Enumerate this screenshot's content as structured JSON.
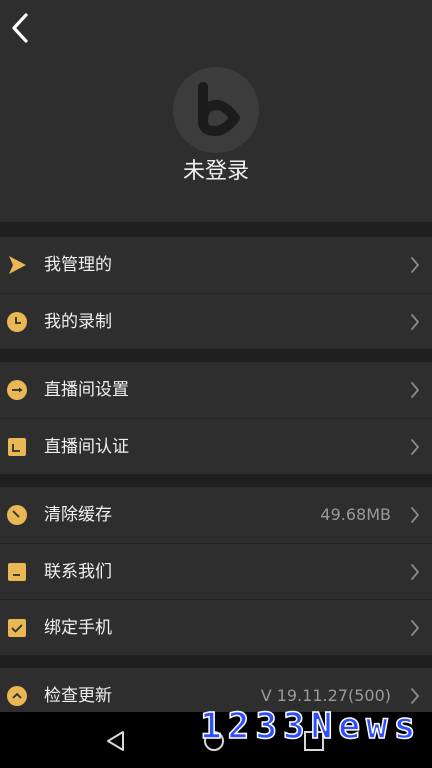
{
  "header": {
    "back_icon": "chevron-left-icon",
    "avatar_icon": "b-logo-icon",
    "login_status": "未登录"
  },
  "menu": {
    "groups": [
      {
        "items": [
          {
            "label": "我管理的",
            "icon": "play-flag-icon"
          },
          {
            "label": "我的录制",
            "icon": "clock-icon"
          }
        ]
      },
      {
        "items": [
          {
            "label": "直播间设置",
            "icon": "arrow-circle-icon"
          },
          {
            "label": "直播间认证",
            "icon": "check-square-icon"
          }
        ]
      },
      {
        "items": [
          {
            "label": "清除缓存",
            "icon": "clean-icon",
            "value": "49.68MB"
          },
          {
            "label": "联系我们",
            "icon": "contact-icon"
          },
          {
            "label": "绑定手机",
            "icon": "bind-phone-icon"
          }
        ]
      },
      {
        "items": [
          {
            "label": "检查更新",
            "icon": "update-icon",
            "value": "V 19.11.27(500)"
          }
        ]
      }
    ],
    "row_chevron_icon": "chevron-right-icon"
  },
  "nav_bar": {
    "back_icon": "nav-back-icon",
    "home_icon": "nav-home-icon",
    "recents_icon": "nav-recents-icon"
  },
  "watermark": "1233News",
  "colors": {
    "background": "#2e2e2e",
    "separator": "#1f1f1f",
    "accent": "#e9b754",
    "text": "#f0f0f0",
    "secondary_text": "#9a9a9a",
    "nav_bar": "#000000"
  }
}
